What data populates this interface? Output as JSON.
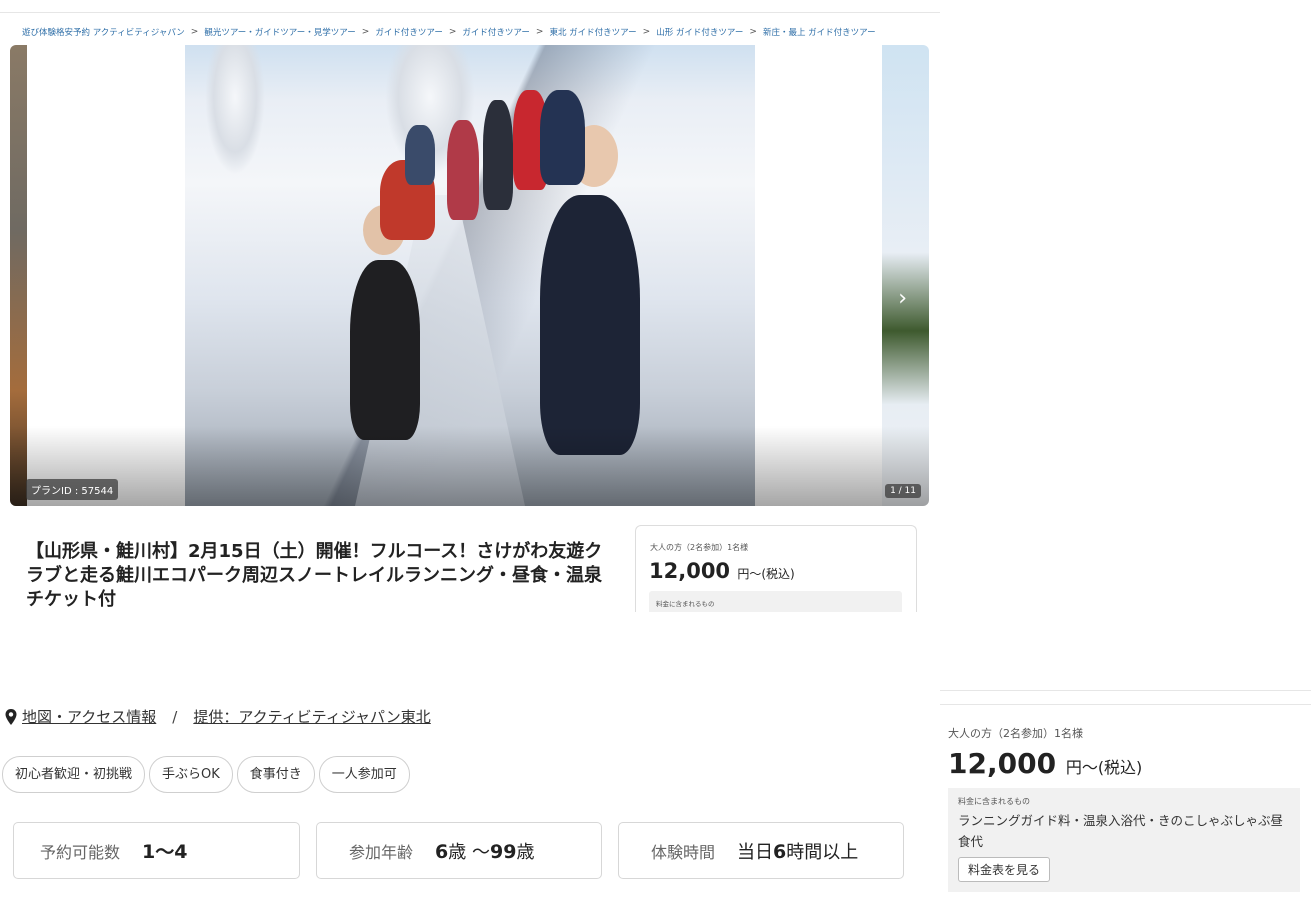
{
  "breadcrumb": [
    "遊び体験格安予約 アクティビティジャパン",
    "観光ツアー・ガイドツアー・見学ツアー",
    "ガイド付きツアー",
    "ガイド付きツアー",
    "東北 ガイド付きツアー",
    "山形 ガイド付きツアー",
    "新庄・最上 ガイド付きツアー"
  ],
  "gallery": {
    "plan_id": "プランID : 57544",
    "counter": "1 / 11"
  },
  "title": "【山形県・鮭川村】2月15日（土）開催！フルコース！さけがわ友遊クラブと走る鮭川エコパーク周辺スノートレイルランニング・昼食・温泉チケット付",
  "price_card_small": {
    "label": "大人の方（2名参加）1名様",
    "amount": "12,000",
    "unit": "円〜(税込)",
    "included_label": "料金に含まれるもの"
  },
  "access": {
    "map_link": "地図・アクセス情報",
    "separator": "/",
    "provider_link": "提供：アクティビティジャパン東北"
  },
  "tags": [
    "初心者歓迎・初挑戦",
    "手ぶらOK",
    "食事付き",
    "一人参加可"
  ],
  "info": {
    "booking": {
      "label": "予約可能数",
      "value": "1〜4"
    },
    "age": {
      "label": "参加年齢",
      "num1": "6",
      "suffix1": "歳 〜",
      "num2": "99",
      "suffix2": "歳"
    },
    "time": {
      "label": "体験時間",
      "prefix": "当日",
      "num": "6",
      "suffix": "時間以上"
    }
  },
  "price_card": {
    "label": "大人の方（2名参加）1名様",
    "amount": "12,000",
    "unit": "円〜(税込)",
    "included_label": "料金に含まれるもの",
    "included": "ランニングガイド料・温泉入浴代・きのこしゃぶしゃぶ昼食代",
    "table_button": "料金表を見る"
  },
  "icons": {
    "pin": "map-pin-icon",
    "next": "chevron-right-icon",
    "breadcrumb_sep": "chevron-right-icon"
  },
  "colors": {
    "breadcrumb_link": "#2f6fa8",
    "border": "#d7d7d7"
  }
}
